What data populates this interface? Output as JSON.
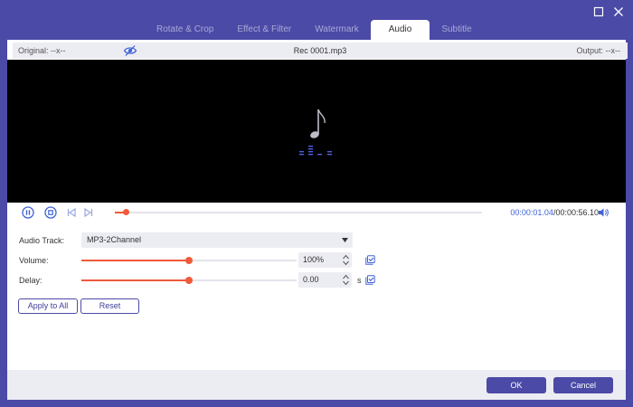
{
  "tabs": [
    {
      "label": "Rotate & Crop"
    },
    {
      "label": "Effect & Filter"
    },
    {
      "label": "Watermark"
    },
    {
      "label": "Audio",
      "active": true
    },
    {
      "label": "Subtitle"
    }
  ],
  "preview": {
    "original_label": "Original: --x--",
    "file_name": "Rec 0001.mp3",
    "output_label": "Output: --x--"
  },
  "playback": {
    "current_time": "00:00:01.04",
    "separator": "/",
    "total_time": "00:00:56.10",
    "progress_fraction": 0.03
  },
  "settings": {
    "audio_track_label": "Audio Track:",
    "audio_track_value": "MP3-2Channel",
    "volume_label": "Volume:",
    "volume_value": "100%",
    "volume_fraction": 0.5,
    "delay_label": "Delay:",
    "delay_value": "0.00",
    "delay_fraction": 0.5,
    "delay_unit": "s"
  },
  "buttons": {
    "apply_to_all": "Apply to All",
    "reset": "Reset",
    "ok": "OK",
    "cancel": "Cancel"
  },
  "colors": {
    "accent": "#4b4aa6",
    "progress": "#f05a3a",
    "time_highlight": "#3f63d8",
    "icon_blue": "#3f63d8"
  }
}
